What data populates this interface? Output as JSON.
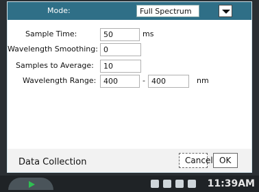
{
  "mode": {
    "label": "Mode:",
    "value": "Full Spectrum"
  },
  "fields": {
    "sample_time": {
      "label": "Sample Time:",
      "value": "50",
      "units": "ms"
    },
    "wavelength_smoothing": {
      "label": "Wavelength Smoothing:",
      "value": "0"
    },
    "samples_to_average": {
      "label": "Samples to Average:",
      "value": "10"
    },
    "wavelength_range": {
      "label": "Wavelength Range:",
      "min": "400",
      "separator": "-",
      "max": "400",
      "units": "nm"
    }
  },
  "footer": {
    "title": "Data Collection",
    "cancel": "Cancel",
    "ok": "OK"
  },
  "taskbar": {
    "time": "11:39AM"
  },
  "icons": [
    "dropdown-icon",
    "start-icon",
    "home-icon",
    "keyboard-icon",
    "network-icon",
    "volume-muted-icon"
  ],
  "colors": {
    "dialog_blue": "#2f6f87",
    "taskbar_dark": "#1f2326"
  }
}
